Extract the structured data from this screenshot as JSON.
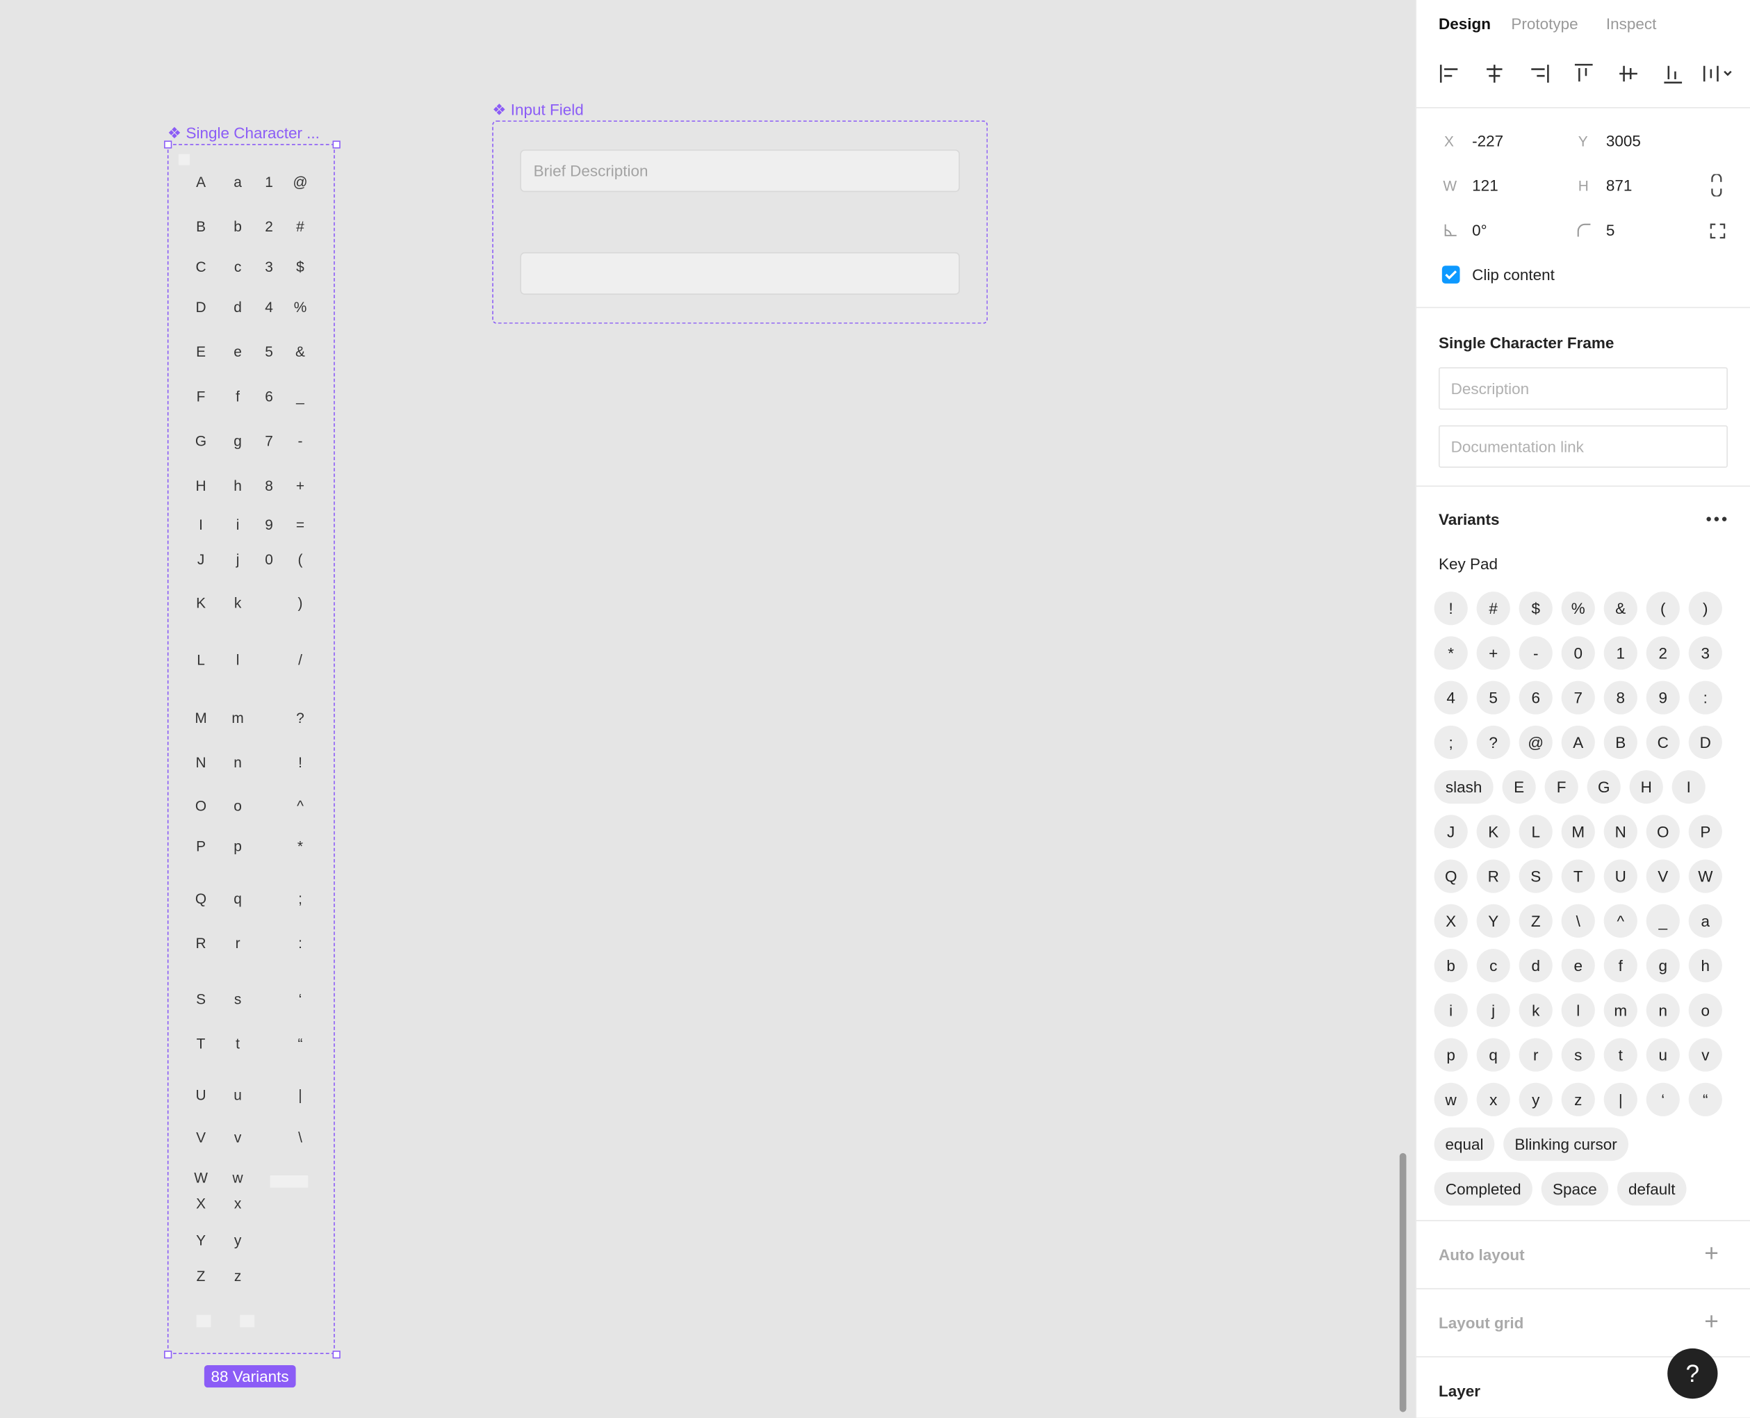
{
  "canvas": {
    "component_set": {
      "label": "Single Character ...",
      "variants_badge": "88 Variants",
      "glyphs": [
        [
          "A",
          "a",
          "1",
          "@"
        ],
        [
          "B",
          "b",
          "2",
          "#"
        ],
        [
          "C",
          "c",
          "3",
          "$"
        ],
        [
          "D",
          "d",
          "4",
          "%"
        ],
        [
          "E",
          "e",
          "5",
          "&"
        ],
        [
          "F",
          "f",
          "6",
          "_"
        ],
        [
          "G",
          "g",
          "7",
          "-"
        ],
        [
          "H",
          "h",
          "8",
          "+"
        ],
        [
          "I",
          "i",
          "9",
          "="
        ],
        [
          "J",
          "j",
          "0",
          "("
        ],
        [
          "K",
          "k",
          "",
          ")"
        ],
        [
          "L",
          "l",
          "",
          "/"
        ],
        [
          "M",
          "m",
          "",
          "?"
        ],
        [
          "N",
          "n",
          "",
          "!"
        ],
        [
          "O",
          "o",
          "",
          "^"
        ],
        [
          "P",
          "p",
          "",
          "*"
        ],
        [
          "Q",
          "q",
          "",
          ";"
        ],
        [
          "R",
          "r",
          "",
          ":"
        ],
        [
          "S",
          "s",
          "",
          "‘"
        ],
        [
          "T",
          "t",
          "",
          "“"
        ],
        [
          "U",
          "u",
          "",
          "|"
        ],
        [
          "V",
          "v",
          "",
          "\\"
        ],
        [
          "W",
          "w",
          "",
          ""
        ],
        [
          "X",
          "x",
          "",
          ""
        ],
        [
          "Y",
          "y",
          "",
          ""
        ],
        [
          "Z",
          "z",
          "",
          ""
        ]
      ]
    },
    "input_field": {
      "label": "Input Field",
      "placeholder": "Brief Description",
      "second_value": ""
    }
  },
  "panel": {
    "tabs": [
      "Design",
      "Prototype",
      "Inspect"
    ],
    "active_tab": "Design",
    "props": {
      "x_label": "X",
      "x": "-227",
      "y_label": "Y",
      "y": "3005",
      "w_label": "W",
      "w": "121",
      "h_label": "H",
      "h": "871",
      "rotation": "0°",
      "radius": "5",
      "clip_content": "Clip content"
    },
    "component": {
      "title": "Single Character Frame",
      "description_placeholder": "Description",
      "doc_link_placeholder": "Documentation link"
    },
    "variants": {
      "title": "Variants",
      "property": "Key Pad",
      "values": [
        "!",
        "#",
        "$",
        "%",
        "&",
        "(",
        ")",
        "*",
        "+",
        "-",
        "0",
        "1",
        "2",
        "3",
        "4",
        "5",
        "6",
        "7",
        "8",
        "9",
        ":",
        ";",
        "?",
        "@",
        "A",
        "B",
        "C",
        "D",
        "slash",
        "E",
        "F",
        "G",
        "H",
        "I",
        "J",
        "K",
        "L",
        "M",
        "N",
        "O",
        "P",
        "Q",
        "R",
        "S",
        "T",
        "U",
        "V",
        "W",
        "X",
        "Y",
        "Z",
        "\\",
        "^",
        "_",
        "a",
        "b",
        "c",
        "d",
        "e",
        "f",
        "g",
        "h",
        "i",
        "j",
        "k",
        "l",
        "m",
        "n",
        "o",
        "p",
        "q",
        "r",
        "s",
        "t",
        "u",
        "v",
        "w",
        "x",
        "y",
        "z",
        "|",
        "‘",
        "“",
        "equal",
        "Blinking cursor",
        "Completed",
        "Space",
        "default"
      ]
    },
    "auto_layout": "Auto layout",
    "layout_grid": "Layout grid",
    "layer": "Layer",
    "help": "?"
  },
  "colors": {
    "accent": "#8b5cf6",
    "checkbox": "#0d99ff",
    "canvas_bg": "#e5e5e5"
  }
}
